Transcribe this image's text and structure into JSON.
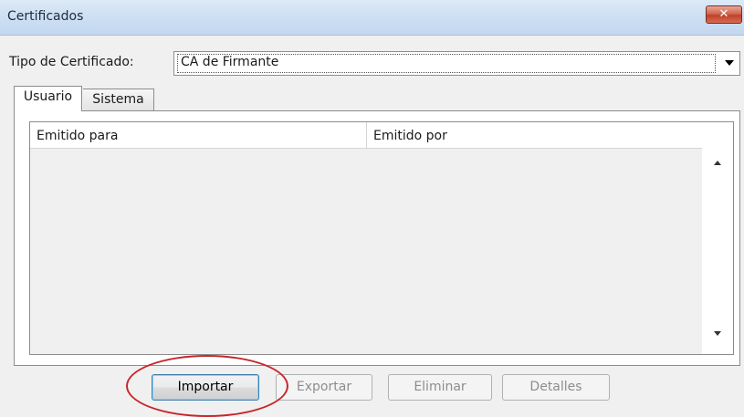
{
  "window": {
    "title": "Certificados",
    "close_icon": "close-icon"
  },
  "type_selector": {
    "label": "Tipo de Certificado:",
    "selected": "CA de Firmante"
  },
  "tabs": [
    {
      "label": "Usuario",
      "active": true
    },
    {
      "label": "Sistema",
      "active": false
    }
  ],
  "table": {
    "columns": [
      "Emitido para",
      "Emitido por"
    ],
    "rows": []
  },
  "buttons": {
    "import": "Importar",
    "export": "Exportar",
    "delete": "Eliminar",
    "details": "Detalles"
  },
  "colors": {
    "close_button": "#c0422b",
    "annotation_ring": "#c6262b",
    "primary_button_border": "#3c7fb1"
  }
}
